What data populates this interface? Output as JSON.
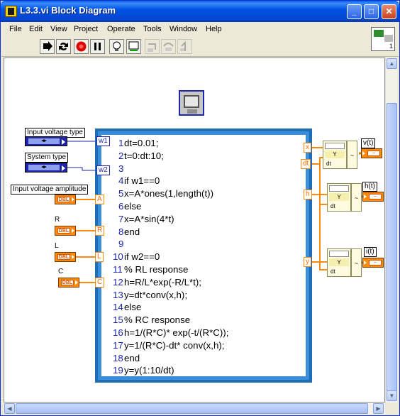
{
  "window": {
    "title": "L3.3.vi Block Diagram",
    "buttons": {
      "minimize": "_",
      "maximize": "□",
      "close": "✕"
    }
  },
  "menubar": {
    "items": [
      "File",
      "Edit",
      "View",
      "Project",
      "Operate",
      "Tools",
      "Window",
      "Help"
    ]
  },
  "toolbar": {
    "tools": [
      "run-arrow-icon",
      "run-continuous-icon",
      "abort-icon",
      "pause-icon",
      "highlight-execution-icon",
      "retain-wire-values-icon",
      "step-into-icon",
      "step-over-icon",
      "step-out-icon"
    ]
  },
  "vi_icon": {
    "label": "1"
  },
  "controls": {
    "input_voltage_type": {
      "label": "Input voltage type",
      "terminal": "w1"
    },
    "system_type": {
      "label": "System type",
      "terminal": "w2"
    },
    "input_voltage_amplitude": {
      "label": "Input voltage amplitude",
      "terminal": "A",
      "dtype": "DBL"
    },
    "R": {
      "label": "R",
      "terminal": "R",
      "dtype": "DBL"
    },
    "L": {
      "label": "L",
      "terminal": "L",
      "dtype": "DBL"
    },
    "C": {
      "label": "C",
      "terminal": "C",
      "dtype": "DBL"
    }
  },
  "ring_value": "◂▸",
  "script": {
    "lines": [
      {
        "n": "1",
        "code": "dt=0.01;"
      },
      {
        "n": "2",
        "code": "t=0:dt:10;"
      },
      {
        "n": "3",
        "code": ""
      },
      {
        "n": "4",
        "code": "if w1==0"
      },
      {
        "n": "5",
        "code": "x=A*ones(1,length(t))"
      },
      {
        "n": "6",
        "code": "else"
      },
      {
        "n": "7",
        "code": "x=A*sin(4*t)"
      },
      {
        "n": "8",
        "code": "end"
      },
      {
        "n": "9",
        "code": ""
      },
      {
        "n": "10",
        "code": "if w2==0"
      },
      {
        "n": "11",
        "code": "% RL response"
      },
      {
        "n": "12",
        "code": "h=R/L*exp(-R/L*t);"
      },
      {
        "n": "13",
        "code": "y=dt*conv(x,h);"
      },
      {
        "n": "14",
        "code": "else"
      },
      {
        "n": "15",
        "code": "% RC response"
      },
      {
        "n": "16",
        "code": "h=1/(R*C)* exp(-t/(R*C));"
      },
      {
        "n": "17",
        "code": "y=1/(R*C)-dt* conv(x,h);"
      },
      {
        "n": "18",
        "code": "end"
      },
      {
        "n": "19",
        "code": "y=y(1:10/dt)"
      }
    ],
    "outputs": [
      "x",
      "dt",
      "h",
      "y"
    ]
  },
  "waveforms": {
    "build_labels": {
      "y": "Y",
      "dt": "dt"
    },
    "indicators": [
      "v(t)",
      "h(t)",
      "i(t)"
    ]
  }
}
